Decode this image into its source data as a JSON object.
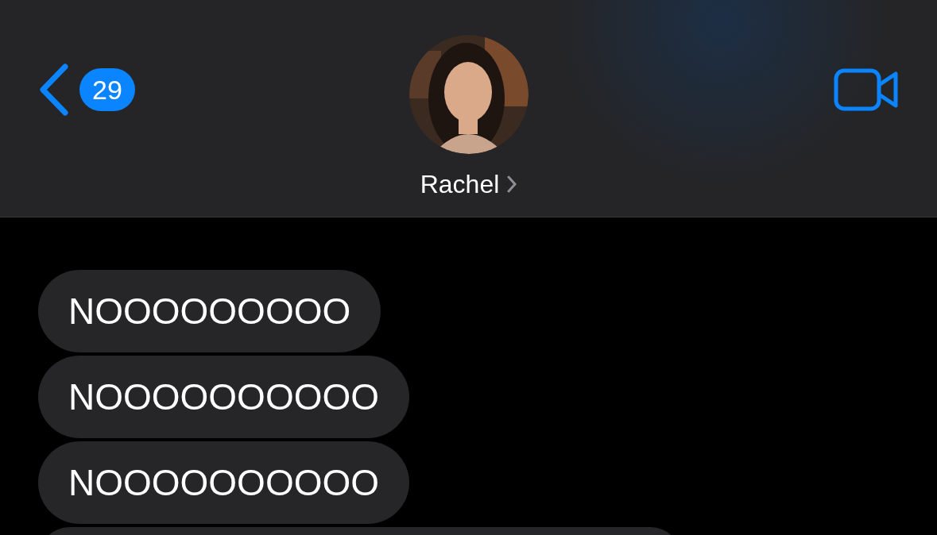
{
  "header": {
    "unread_count": "29",
    "contact_name": "Rachel"
  },
  "messages": [
    {
      "text": "NOOOOOOOOO"
    },
    {
      "text": "NOOOOOOOOOO"
    },
    {
      "text": "NOOOOOOOOOO"
    }
  ]
}
